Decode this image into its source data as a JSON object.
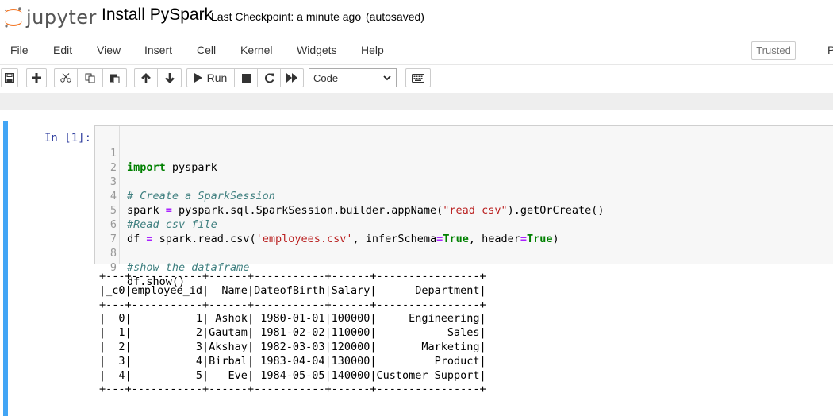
{
  "header": {
    "logo_text": "jupyter",
    "notebook_name": "Install PySpark",
    "checkpoint": "Last Checkpoint: a minute ago",
    "autosave_status": "(autosaved)"
  },
  "menubar": {
    "items": [
      "File",
      "Edit",
      "View",
      "Insert",
      "Cell",
      "Kernel",
      "Widgets",
      "Help"
    ],
    "trusted_label": "Trusted",
    "truncated_label": "P"
  },
  "toolbar": {
    "run_label": "Run",
    "cell_type": "Code",
    "icons": [
      "save-icon",
      "plus-icon",
      "cut-icon",
      "copy-icon",
      "paste-icon",
      "arrow-up-icon",
      "arrow-down-icon",
      "play-icon",
      "stop-icon",
      "restart-icon",
      "fast-forward-icon",
      "keyboard-icon"
    ]
  },
  "cell": {
    "prompt": "In [1]:",
    "line_numbers": [
      "1",
      "2",
      "3",
      "4",
      "5",
      "6",
      "7",
      "8",
      "9"
    ],
    "code_lines": [
      "import pyspark",
      "",
      "# Create a SparkSession",
      "spark = pyspark.sql.SparkSession.builder.appName(\"read csv\").getOrCreate()",
      "#Read csv file",
      "df = spark.read.csv('employees.csv', inferSchema=True, header=True)",
      "",
      "#show the dataframe",
      "df.show()"
    ],
    "output": "+---+-----------+------+-----------+------+----------------+\n|_c0|employee_id|  Name|DateofBirth|Salary|      Department|\n+---+-----------+------+-----------+------+----------------+\n|  0|          1| Ashok| 1980-01-01|100000|     Engineering|\n|  1|          2|Gautam| 1981-02-02|110000|           Sales|\n|  2|          3|Akshay| 1982-03-03|120000|       Marketing|\n|  3|          4|Birbal| 1983-04-04|130000|         Product|\n|  4|          5|   Eve| 1984-05-05|140000|Customer Support|\n+---+-----------+------+-----------+------+----------------+"
  },
  "colors": {
    "cell_selected_bar": "#42a5f5",
    "prompt": "#303f9f",
    "logo_orange": "#f37726"
  }
}
